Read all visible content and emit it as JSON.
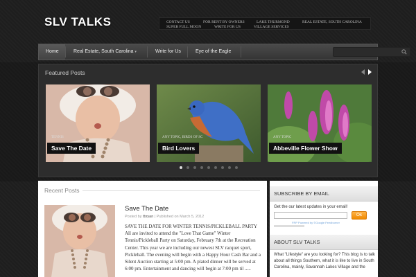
{
  "site": {
    "title": "SLV TALKS"
  },
  "topnav": {
    "items": [
      "CONTACT US",
      "FOR RENT BY OWNERS",
      "LAKE THURMOND",
      "REAL ESTATE, SOUTH CAROLINA",
      "SUPER FULL MOON",
      "WRITE FOR US",
      "VILLAGE SERVICES"
    ]
  },
  "mainnav": {
    "items": [
      "Home",
      "Real Estate, South Carolina",
      "Write for Us",
      "Eye of the Eagle"
    ],
    "submenu_indicator": "▾"
  },
  "search": {
    "placeholder": "",
    "icon": "search-icon"
  },
  "featured": {
    "heading": "Featured Posts",
    "slides": [
      {
        "category": "TENNIS",
        "title": "Save The Date"
      },
      {
        "category": "ANY TOPIC, BIRDS OF SC",
        "title": "Bird Lovers"
      },
      {
        "category": "ANY TOPIC",
        "title": "Abbeville Flower Show"
      }
    ],
    "dot_count": 10,
    "active_dot": 0
  },
  "recent": {
    "heading": "Recent Posts",
    "post": {
      "title": "Save The Date",
      "posted_by_label": "Posted by",
      "author": "tbryan",
      "published_label": "| Published on March 5, 2012",
      "body": "SAVE THE DATE FOR WINTER TENNIS/PICKLEBALL PARTY All are invited to attend the \"Love That Game\" Winter Tennis/Pickleball Party on Saturday, February 7th at the Recreation Center. This year we are including our newest SLV racquet sport, Pickleball. The evening will begin with a Happy Hour Cash Bar and a Silent Auction starting at 5:00 pm. A plated dinner will be served at 6:00 pm. Entertainment and dancing will begin at 7:00 pm til ....."
    }
  },
  "sidebar": {
    "subscribe_heading": "SUBSCRIBE BY EMAIL",
    "subscribe_text": "Get the our latest updates in your email!",
    "email_value": "",
    "ok_label": "Ok",
    "powered_by": "FRP Powered by ©Google Feedburner",
    "about_heading": "ABOUT SLV TALKS",
    "about_text": "What \"Lifestyle\" are you looking for? This blog is to talk about all things Southern, what it is like to live in South Carolina, mainly, Savannah Lakes Village and the"
  },
  "colors": {
    "accent_orange": "#f08a00",
    "dark_bg": "#1e1e1e",
    "caption_bg": "#111111"
  }
}
